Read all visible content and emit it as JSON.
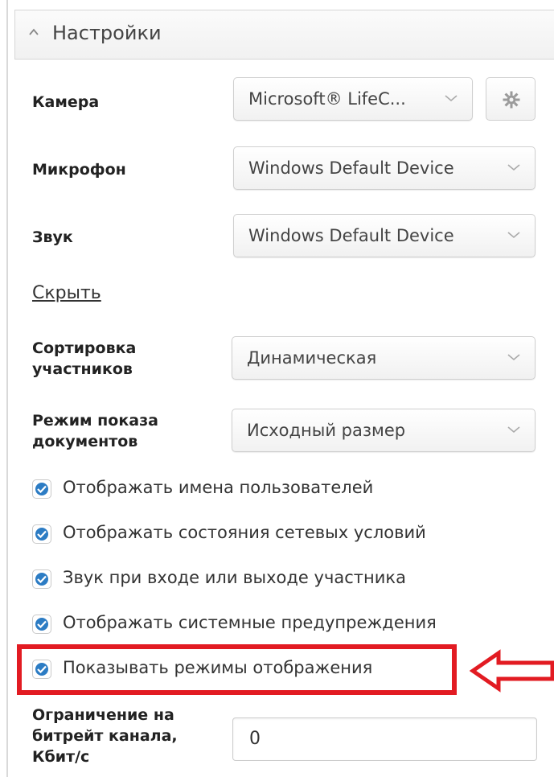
{
  "header": {
    "title": "Настройки"
  },
  "devices": {
    "camera": {
      "label": "Камера",
      "value": "Microsoft® LifeC..."
    },
    "microphone": {
      "label": "Микрофон",
      "value": "Windows Default Device"
    },
    "sound": {
      "label": "Звук",
      "value": "Windows Default Device"
    }
  },
  "hide_link": "Скрыть",
  "sorting": {
    "label_line1": "Сортировка",
    "label_line2": "участников",
    "value": "Динамическая"
  },
  "doc_mode": {
    "label_line1": "Режим показа",
    "label_line2": "документов",
    "value": "Исходный размер"
  },
  "checkboxes": [
    {
      "label": "Отображать имена пользователей",
      "checked": true
    },
    {
      "label": "Отображать состояния сетевых условий",
      "checked": true
    },
    {
      "label": "Звук при входе или выходе участника",
      "checked": true
    },
    {
      "label": "Отображать системные предупреждения",
      "checked": true
    },
    {
      "label": "Показывать режимы отображения",
      "checked": true
    }
  ],
  "bitrate": {
    "label_line1": "Ограничение на",
    "label_line2": "битрейт канала,",
    "label_line3": "Кбит/с",
    "value": "0"
  },
  "colors": {
    "accent": "#2c7cc4",
    "highlight": "#e21b22"
  },
  "icons": {
    "header": "chevron-up-icon",
    "dropdown": "chevron-down-icon",
    "camera_settings": "gear-icon",
    "checkbox": "checkmark-icon",
    "annotation": "arrow-left-icon"
  }
}
